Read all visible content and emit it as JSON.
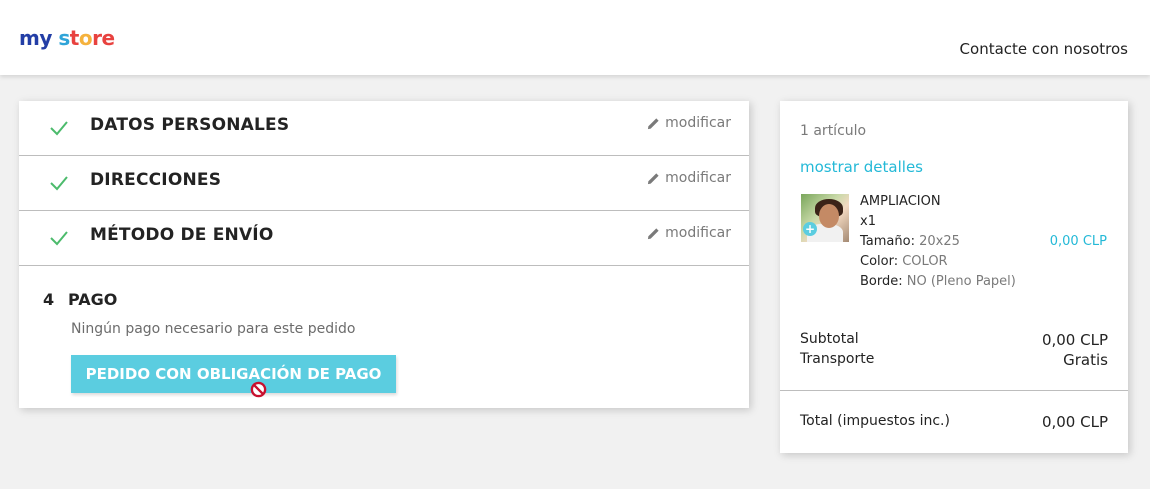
{
  "header": {
    "logo": {
      "part1": "my",
      "part2": " s",
      "part3": "t",
      "part4": "o",
      "part5": "re"
    },
    "contact_link": "Contacte con nosotros"
  },
  "checkout": {
    "steps": [
      {
        "title": "DATOS PERSONALES",
        "edit_label": "modificar",
        "completed": true
      },
      {
        "title": "DIRECCIONES",
        "edit_label": "modificar",
        "completed": true
      },
      {
        "title": "MÉTODO DE ENVÍO",
        "edit_label": "modificar",
        "completed": true
      }
    ],
    "payment": {
      "number": "4",
      "title": "PAGO",
      "note": "Ningún pago necesario para este pedido",
      "button_label": "PEDIDO CON OBLIGACIÓN DE PAGO"
    }
  },
  "cart": {
    "item_count": "1 artículo",
    "details_link": "mostrar detalles",
    "product": {
      "name": "AMPLIACION",
      "quantity": "x1",
      "price": "0,00 CLP",
      "attributes": [
        {
          "label": "Tamaño:",
          "value": "20x25"
        },
        {
          "label": "Color:",
          "value": "COLOR"
        },
        {
          "label": "Borde:",
          "value": "NO (Pleno Papel)"
        }
      ]
    },
    "subtotal_label": "Subtotal",
    "subtotal_value": "0,00 CLP",
    "shipping_label": "Transporte",
    "shipping_value": "Gratis",
    "total_label": "Total (impuestos inc.)",
    "total_value": "0,00 CLP"
  },
  "colors": {
    "accent": "#24b9d7",
    "button": "#5bcde0",
    "check": "#4cbb6c"
  },
  "icons": [
    "checkmark-icon",
    "pencil-icon",
    "not-allowed-cursor-icon",
    "zoom-plus-icon"
  ]
}
